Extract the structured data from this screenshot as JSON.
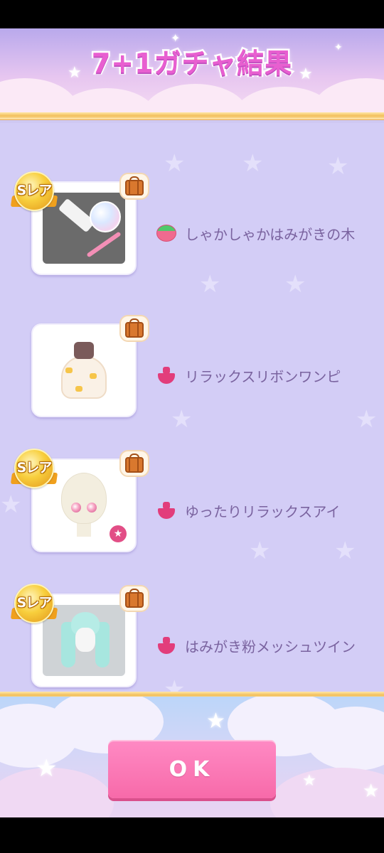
{
  "dialog": {
    "title": "7+1ガチャ結果"
  },
  "rarity_label": "Sレア",
  "results": [
    {
      "name": "しゃかしゃかはみがきの木",
      "category": "fruit-icon",
      "rare": true
    },
    {
      "name": "リラックスリボンワンピ",
      "category": "dress-icon",
      "rare": false
    },
    {
      "name": "ゆったりリラックスアイ",
      "category": "dress-icon",
      "rare": true
    },
    {
      "name": "はみがき粉メッシュツイン",
      "category": "dress-icon",
      "rare": true
    }
  ],
  "footer": {
    "ok_label": "OK"
  },
  "colors": {
    "title": "#e85fd0",
    "text": "#7a639f",
    "button": "#f76aa9",
    "background": "#d3cdf6"
  }
}
